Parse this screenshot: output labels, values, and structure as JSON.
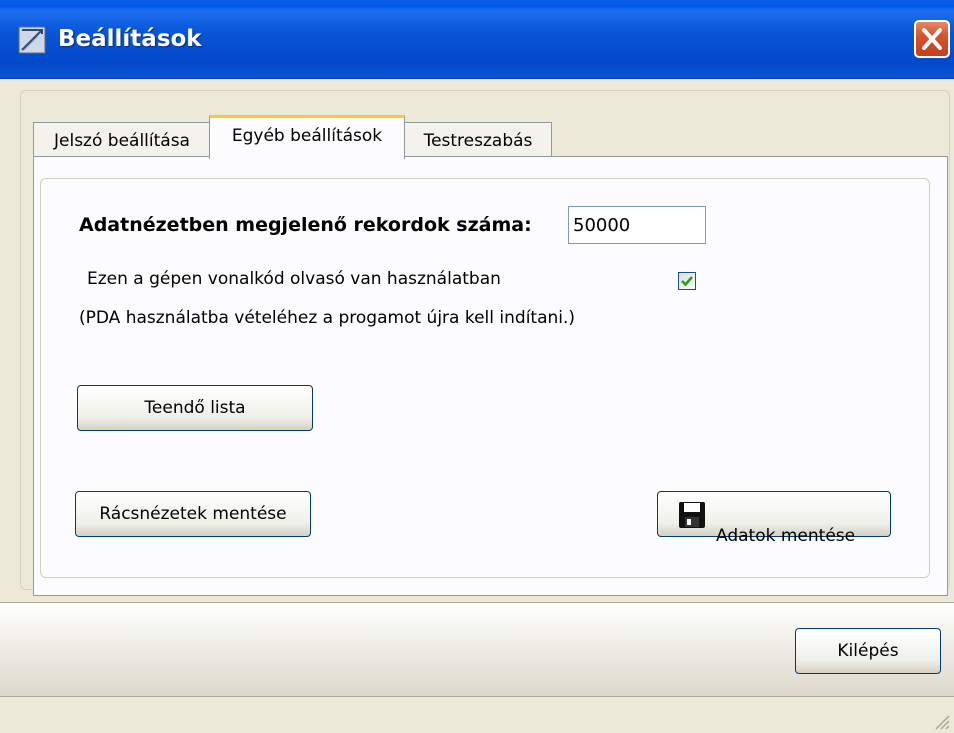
{
  "window": {
    "title": "Beállítások"
  },
  "tabs": [
    {
      "label": "Jelszó beállítása"
    },
    {
      "label": "Egyéb beállítások"
    },
    {
      "label": "Testreszabás"
    }
  ],
  "form": {
    "records_label": "Adatnézetben megjelenő rekordok száma:",
    "records_value": "50000",
    "barcode_label": "Ezen a gépen vonalkód olvasó van használatban",
    "barcode_checked": true,
    "barcode_note": "(PDA használatba vételéhez a progamot újra kell indítani.)"
  },
  "buttons": {
    "todo_list": "Teendő lista",
    "save_grid_views": "Rácsnézetek mentése",
    "save_data": "Adatok mentése",
    "exit": "Kilépés"
  },
  "colors": {
    "titlebar": "#0054e3",
    "tab_highlight": "#ffc83c",
    "checkmark": "#21a121",
    "close_button": "#d8542e"
  }
}
